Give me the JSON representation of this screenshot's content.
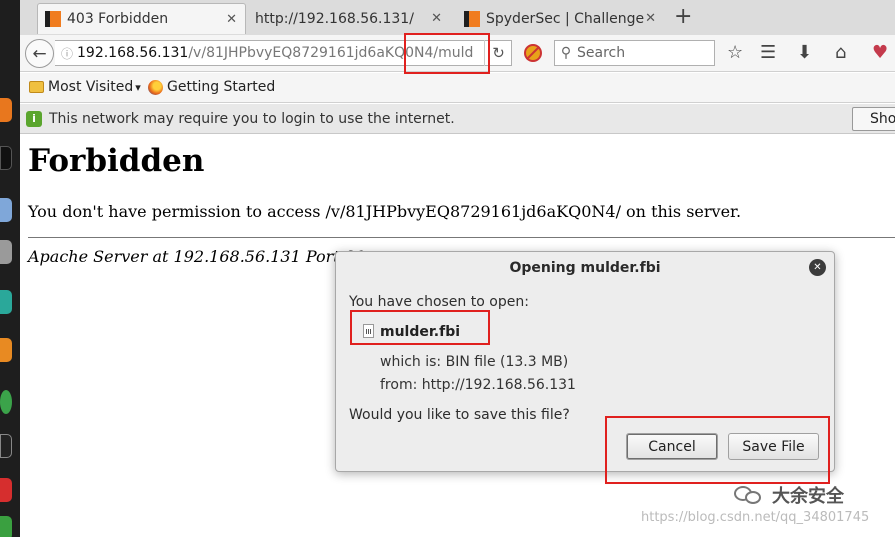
{
  "tabs": [
    {
      "title": "403 Forbidden",
      "active": true
    },
    {
      "title": "http://192.168.56.131/",
      "active": false
    },
    {
      "title": "SpyderSec | Challenge",
      "active": false
    }
  ],
  "urlbar": {
    "host": "192.168.56.131",
    "path": "/v/81JHPbvyEQ8729161jd6aKQ0N4/muld"
  },
  "search": {
    "placeholder": "Search"
  },
  "bookmarks": [
    {
      "label": "Most Visited"
    },
    {
      "label": "Getting Started"
    }
  ],
  "notification": {
    "text": "This network may require you to login to use the internet.",
    "button": "Sho"
  },
  "page": {
    "heading": "Forbidden",
    "message": "You don't have permission to access /v/81JHPbvyEQ8729161jd6aKQ0N4/ on this server.",
    "address": "Apache Server at 192.168.56.131 Port 80"
  },
  "dialog": {
    "title": "Opening mulder.fbi",
    "intro": "You have chosen to open:",
    "filename": "mulder.fbi",
    "which_is": "which is: BIN file (13.3 MB)",
    "from": "from: http://192.168.56.131",
    "question": "Would you like to save this file?",
    "cancel": "Cancel",
    "save": "Save File"
  },
  "watermark": {
    "brand": "大余安全",
    "url": "https://blog.csdn.net/qq_34801745"
  },
  "colors": {
    "tab_accent": "#f07c1f",
    "annotation_red": "#e0201e"
  }
}
